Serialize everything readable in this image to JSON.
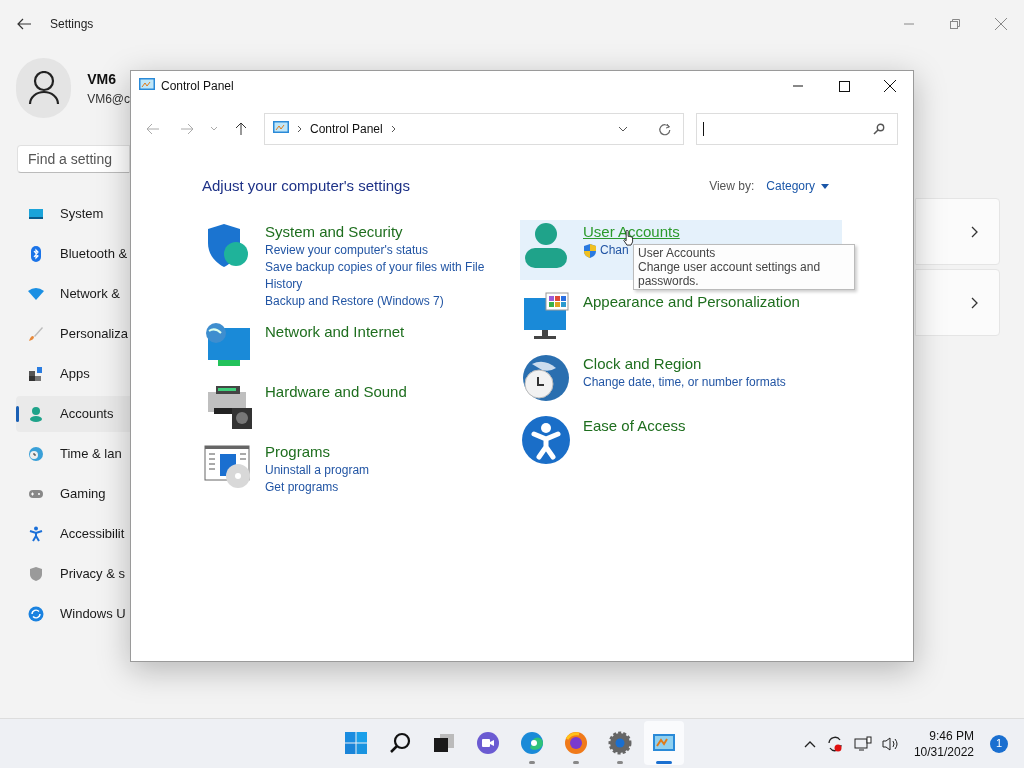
{
  "settings": {
    "title": "Settings",
    "user": {
      "name": "VM6",
      "email": "VM6@c"
    },
    "search": {
      "placeholder": "Find a setting"
    },
    "nav": [
      {
        "label": "System",
        "kind": "system",
        "selected": false
      },
      {
        "label": "Bluetooth &",
        "kind": "bluetooth",
        "selected": false
      },
      {
        "label": "Network &",
        "kind": "network",
        "selected": false
      },
      {
        "label": "Personaliza",
        "kind": "brush",
        "selected": false
      },
      {
        "label": "Apps",
        "kind": "apps",
        "selected": false
      },
      {
        "label": "Accounts",
        "kind": "accounts",
        "selected": true
      },
      {
        "label": "Time & lan",
        "kind": "time",
        "selected": false
      },
      {
        "label": "Gaming",
        "kind": "gaming",
        "selected": false
      },
      {
        "label": "Accessibilit",
        "kind": "access",
        "selected": false
      },
      {
        "label": "Privacy & s",
        "kind": "privacy",
        "selected": false
      },
      {
        "label": "Windows U",
        "kind": "update",
        "selected": false
      }
    ]
  },
  "control_panel": {
    "title": "Control Panel",
    "breadcrumb": [
      "Control Panel"
    ],
    "heading": "Adjust your computer's settings",
    "view_by": {
      "label": "View by:",
      "value": "Category"
    },
    "columns": [
      [
        {
          "kind": "security",
          "name": "System and Security",
          "hovered": false,
          "links": [
            {
              "text": "Review your computer's status",
              "shield": false
            },
            {
              "text": "Save backup copies of your files with File History",
              "shield": false
            },
            {
              "text": "Backup and Restore (Windows 7)",
              "shield": false
            }
          ]
        },
        {
          "kind": "network",
          "name": "Network and Internet",
          "hovered": false
        },
        {
          "kind": "hardware",
          "name": "Hardware and Sound",
          "hovered": false
        },
        {
          "kind": "programs",
          "name": "Programs",
          "hovered": false,
          "links": [
            {
              "text": "Uninstall a program",
              "shield": false
            },
            {
              "text": "Get programs",
              "shield": false
            }
          ]
        }
      ],
      [
        {
          "kind": "user",
          "name": "User Accounts",
          "hovered": true,
          "links": [
            {
              "text": "Chan",
              "shield": true
            }
          ]
        },
        {
          "kind": "appearance",
          "name": "Appearance and Personalization",
          "hovered": false
        },
        {
          "kind": "clock",
          "name": "Clock and Region",
          "hovered": false,
          "links": [
            {
              "text": "Change date, time, or number formats",
              "shield": false
            }
          ]
        },
        {
          "kind": "access",
          "name": "Ease of Access",
          "hovered": false
        }
      ]
    ],
    "tooltip": {
      "title": "User Accounts",
      "text": "Change user account settings and passwords."
    }
  },
  "taskbar": {
    "apps": [
      {
        "kind": "start",
        "running": false,
        "selected": false
      },
      {
        "kind": "search",
        "running": false,
        "selected": false
      },
      {
        "kind": "taskview",
        "running": false,
        "selected": false
      },
      {
        "kind": "chat",
        "running": false,
        "selected": false
      },
      {
        "kind": "edge",
        "running": true,
        "selected": false
      },
      {
        "kind": "firefox",
        "running": true,
        "selected": false
      },
      {
        "kind": "settings",
        "running": true,
        "selected": false
      },
      {
        "kind": "controlpanel",
        "running": true,
        "selected": true
      }
    ],
    "time": "9:46 PM",
    "date": "10/31/2022",
    "notifications": "1"
  }
}
